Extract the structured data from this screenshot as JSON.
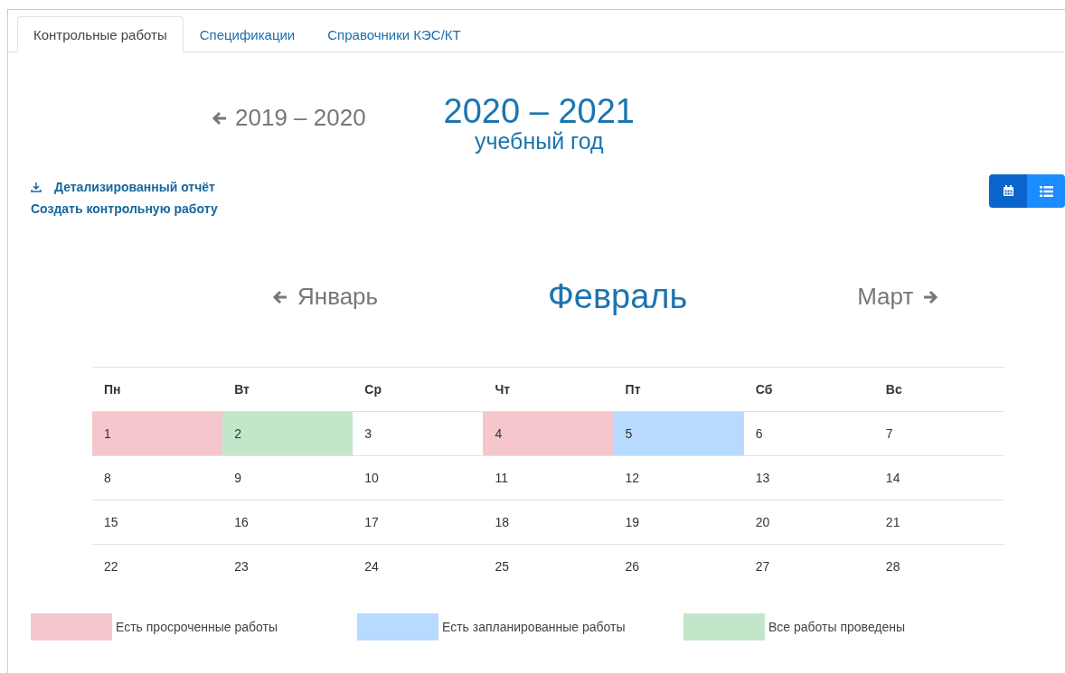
{
  "tabs": [
    {
      "label": "Контрольные работы",
      "selected": true
    },
    {
      "label": "Спецификации",
      "selected": false
    },
    {
      "label": "Справочники КЭС/КТ",
      "selected": false
    }
  ],
  "year_nav": {
    "previous": "2019 – 2020",
    "current": "2020 – 2021",
    "caption": "учебный год"
  },
  "actions": [
    {
      "label": "Детализированный отчёт",
      "kind": "download"
    },
    {
      "label": "Создать контрольную работу",
      "kind": "plain"
    }
  ],
  "view_toggle": [
    {
      "kind": "calendar",
      "selected": true
    },
    {
      "kind": "list",
      "selected": false
    }
  ],
  "month_nav": {
    "previous": "Январь",
    "current": "Февраль",
    "next": "Март"
  },
  "calendar": {
    "weekdays": [
      "Пн",
      "Вт",
      "Ср",
      "Чт",
      "Пт",
      "Сб",
      "Вс"
    ],
    "weeks": [
      [
        {
          "day": "1",
          "color": "#f5c6cb"
        },
        {
          "day": "2",
          "color": "#c3e6cb"
        },
        {
          "day": "3"
        },
        {
          "day": "4",
          "color": "#f5c6cb"
        },
        {
          "day": "5",
          "color": "#b8daff"
        },
        {
          "day": "6"
        },
        {
          "day": "7"
        }
      ],
      [
        {
          "day": "8"
        },
        {
          "day": "9"
        },
        {
          "day": "10"
        },
        {
          "day": "11"
        },
        {
          "day": "12"
        },
        {
          "day": "13"
        },
        {
          "day": "14"
        }
      ],
      [
        {
          "day": "15"
        },
        {
          "day": "16"
        },
        {
          "day": "17"
        },
        {
          "day": "18"
        },
        {
          "day": "19"
        },
        {
          "day": "20"
        },
        {
          "day": "21"
        }
      ],
      [
        {
          "day": "22"
        },
        {
          "day": "23"
        },
        {
          "day": "24"
        },
        {
          "day": "25"
        },
        {
          "day": "26"
        },
        {
          "day": "27"
        },
        {
          "day": "28"
        }
      ]
    ]
  },
  "legend": [
    {
      "label": "Есть просроченные работы",
      "color": "#f5c6cb"
    },
    {
      "label": "Есть запланированные работы",
      "color": "#b8daff"
    },
    {
      "label": "Все работы проведены",
      "color": "#c3e6cb"
    }
  ]
}
